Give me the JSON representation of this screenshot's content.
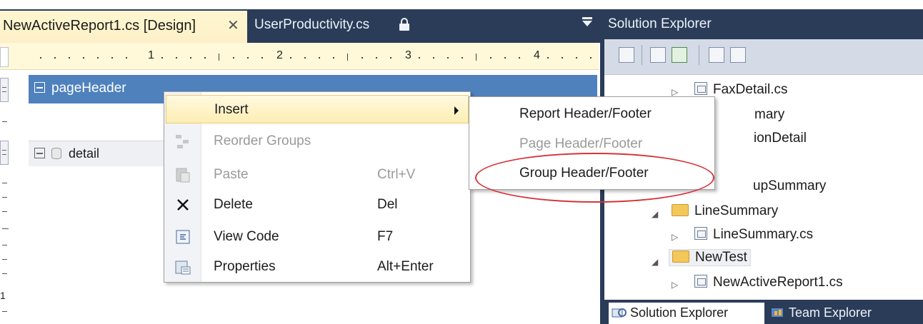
{
  "editor": {
    "active_tab": "NewActiveReport1.cs [Design]",
    "close_glyph": "✕",
    "second_tab": "UserProductivity.cs",
    "ruler_labels": [
      "1",
      "2",
      "3",
      "4"
    ],
    "vertical_ruler_label": "1"
  },
  "sections": {
    "page_header": "pageHeader",
    "detail": "detail"
  },
  "context_menu": {
    "items": [
      {
        "label": "Insert",
        "shortcut": "",
        "icon": "none",
        "state": "highlighted",
        "has_submenu": true
      },
      {
        "label": "Reorder Groups",
        "shortcut": "",
        "icon": "reorder-groups-icon",
        "state": "disabled"
      },
      {
        "label": "Paste",
        "shortcut": "Ctrl+V",
        "icon": "paste-icon",
        "state": "disabled"
      },
      {
        "label": "Delete",
        "shortcut": "Del",
        "icon": "delete-x-icon",
        "state": "enabled"
      },
      {
        "label": "View Code",
        "shortcut": "F7",
        "icon": "view-code-icon",
        "state": "enabled"
      },
      {
        "label": "Properties",
        "shortcut": "Alt+Enter",
        "icon": "properties-icon",
        "state": "enabled"
      }
    ]
  },
  "submenu": {
    "items": [
      {
        "label": "Report Header/Footer",
        "state": "enabled"
      },
      {
        "label": "Page Header/Footer",
        "state": "disabled"
      },
      {
        "label": "Group Header/Footer",
        "state": "enabled",
        "circled": true
      }
    ],
    "circle_color": "#d4343a"
  },
  "solution_explorer": {
    "title": "Solution Explorer",
    "tree": [
      {
        "label": "FaxDetail.cs",
        "icon": "cs-file-icon"
      },
      {
        "label": "mary",
        "icon": "none"
      },
      {
        "label": "ionDetail",
        "icon": "none"
      },
      {
        "label": "upSummary",
        "icon": "none"
      },
      {
        "label": "LineSummary",
        "icon": "folder-icon"
      },
      {
        "label": "LineSummary.cs",
        "icon": "cs-file-icon"
      },
      {
        "label": "NewTest",
        "icon": "folder-icon",
        "selected": true
      },
      {
        "label": "NewActiveReport1.cs",
        "icon": "cs-file-icon"
      }
    ],
    "bottom_tabs": [
      "Solution Explorer",
      "Team Explorer"
    ]
  },
  "colors": {
    "chrome_dark": "#2b3c59",
    "selection_blue": "#4f81bd",
    "menu_highlight": "#fdeeb5"
  }
}
